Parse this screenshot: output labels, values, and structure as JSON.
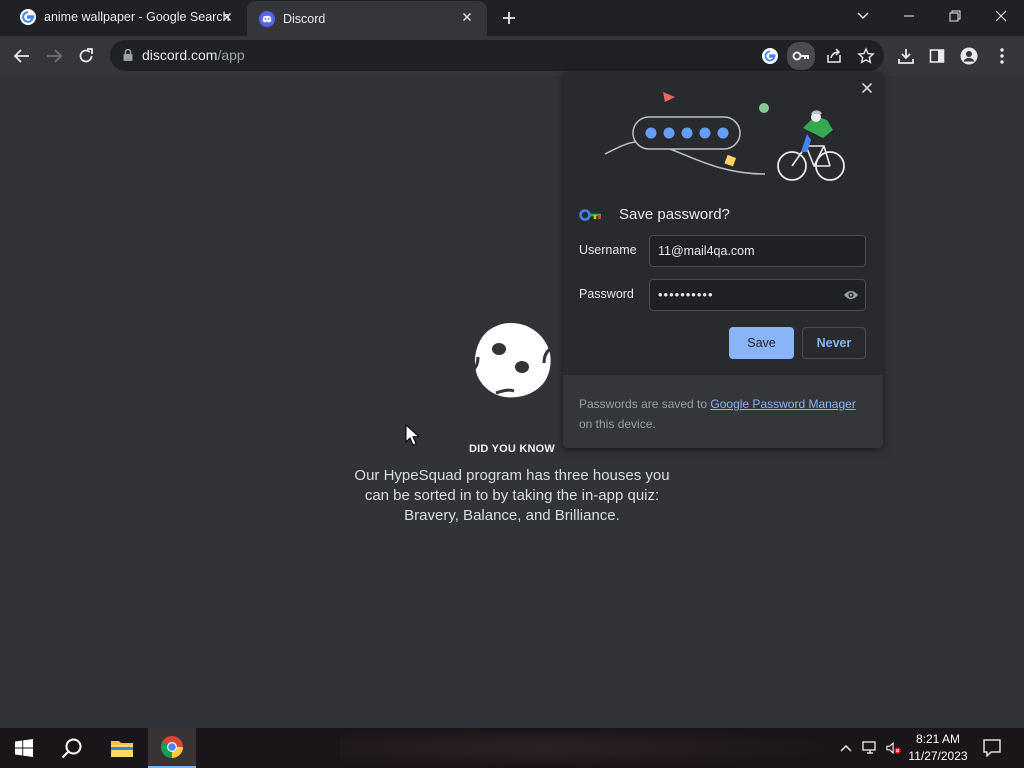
{
  "browser": {
    "tabs": [
      {
        "title": "anime wallpaper - Google Search",
        "favicon": "google-g-icon",
        "active": false
      },
      {
        "title": "Discord",
        "favicon": "discord-icon",
        "active": true
      }
    ],
    "url_host": "discord.com",
    "url_path": "/app"
  },
  "page": {
    "heading": "DID YOU KNOW",
    "tip": "Our HypeSquad program has three houses you can be sorted in to by taking the in-app quiz: Bravery, Balance, and Brilliance."
  },
  "password_popup": {
    "title": "Save password?",
    "username_label": "Username",
    "username_value": "11@mail4qa.com",
    "password_label": "Password",
    "password_value": "••••••••••",
    "save_label": "Save",
    "never_label": "Never",
    "footer_prefix": "Passwords are saved to ",
    "footer_link": "Google Password Manager",
    "footer_suffix": " on this device."
  },
  "taskbar": {
    "time": "8:21 AM",
    "date": "11/27/2023"
  },
  "colors": {
    "page_bg": "#313338",
    "accent_blue": "#8ab4f8",
    "toolbar": "#35363a",
    "tabstrip": "#202124"
  }
}
